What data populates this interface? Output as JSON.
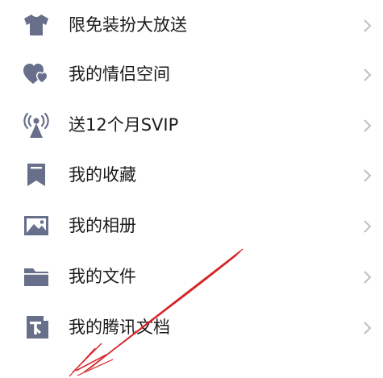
{
  "colors": {
    "icon": "#676f8a",
    "text": "#1b1b1b",
    "chevron": "#bfbfbf",
    "annotation_arrow": "#d6262b"
  },
  "menu": {
    "items": [
      {
        "label": "限免装扮大放送",
        "icon": "tshirt-icon"
      },
      {
        "label": "我的情侣空间",
        "icon": "couple-hearts-icon"
      },
      {
        "label": "送12个月SVIP",
        "icon": "broadcast-tower-icon"
      },
      {
        "label": "我的收藏",
        "icon": "bookmark-icon"
      },
      {
        "label": "我的相册",
        "icon": "photo-album-icon"
      },
      {
        "label": "我的文件",
        "icon": "folder-icon"
      },
      {
        "label": "我的腾讯文档",
        "icon": "tencent-docs-icon"
      }
    ]
  }
}
